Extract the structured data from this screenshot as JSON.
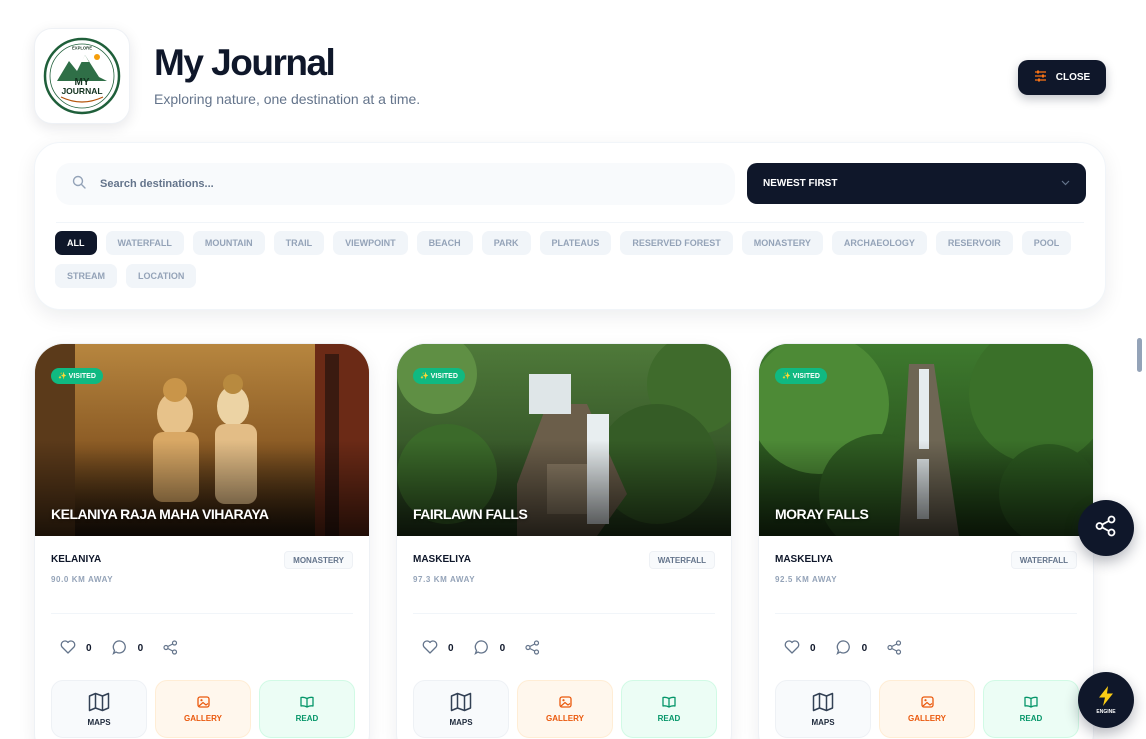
{
  "header": {
    "logo_text_top": "EXPLORE",
    "logo_text_my": "MY",
    "logo_text_journal": "JOURNAL",
    "title": "My Journal",
    "subtitle": "Exploring nature, one destination at a time.",
    "close_label": "CLOSE"
  },
  "filters": {
    "search_placeholder": "Search destinations...",
    "sort_value": "NEWEST FIRST",
    "chips": [
      {
        "label": "ALL",
        "active": true
      },
      {
        "label": "WATERFALL",
        "active": false
      },
      {
        "label": "MOUNTAIN",
        "active": false
      },
      {
        "label": "TRAIL",
        "active": false
      },
      {
        "label": "VIEWPOINT",
        "active": false
      },
      {
        "label": "BEACH",
        "active": false
      },
      {
        "label": "PARK",
        "active": false
      },
      {
        "label": "PLATEAUS",
        "active": false
      },
      {
        "label": "RESERVED FOREST",
        "active": false
      },
      {
        "label": "MONASTERY",
        "active": false
      },
      {
        "label": "ARCHAEOLOGY",
        "active": false
      },
      {
        "label": "RESERVOIR",
        "active": false
      },
      {
        "label": "POOL",
        "active": false
      },
      {
        "label": "STREAM",
        "active": false
      },
      {
        "label": "LOCATION",
        "active": false
      }
    ]
  },
  "cards": [
    {
      "badge": "✨ VISITED",
      "title": "KELANIYA RAJA MAHA VIHARAYA",
      "location": "KELANIYA",
      "distance": "90.0 KM AWAY",
      "category": "MONASTERY",
      "likes": "0",
      "comments": "0",
      "maps_label": "MAPS",
      "gallery_label": "GALLERY",
      "read_label": "READ"
    },
    {
      "badge": "✨ VISITED",
      "title": "FAIRLAWN FALLS",
      "location": "MASKELIYA",
      "distance": "97.3 KM AWAY",
      "category": "WATERFALL",
      "likes": "0",
      "comments": "0",
      "maps_label": "MAPS",
      "gallery_label": "GALLERY",
      "read_label": "READ"
    },
    {
      "badge": "✨ VISITED",
      "title": "MORAY FALLS",
      "location": "MASKELIYA",
      "distance": "92.5 KM AWAY",
      "category": "WATERFALL",
      "likes": "0",
      "comments": "0",
      "maps_label": "MAPS",
      "gallery_label": "GALLERY",
      "read_label": "READ"
    }
  ],
  "fab": {
    "share_icon": "share-icon",
    "engine_label": "ENGINE"
  },
  "colors": {
    "dark": "#0f172a",
    "visited_green": "#10b981",
    "gallery_orange": "#ea580c",
    "read_green": "#059669",
    "muted": "#94a3b8"
  }
}
